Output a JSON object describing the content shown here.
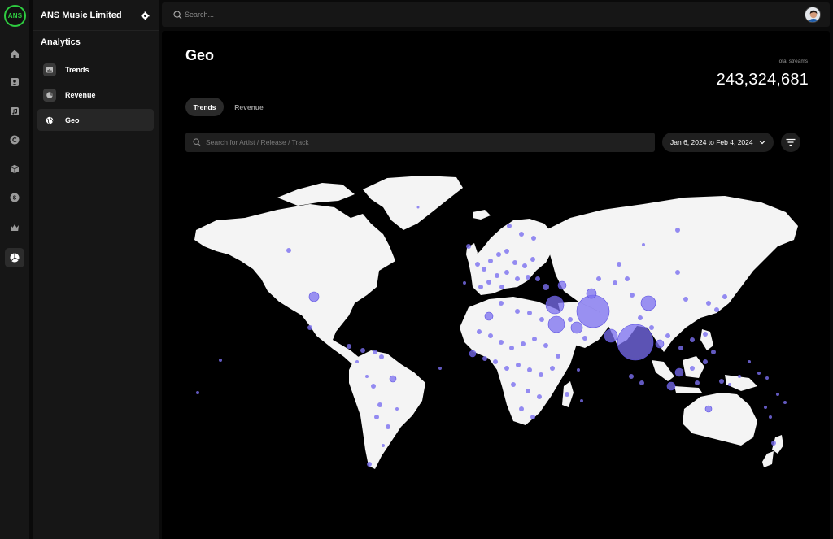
{
  "rail": {
    "logo": "ANS",
    "items": [
      {
        "icon": "home-icon"
      },
      {
        "icon": "artist-icon"
      },
      {
        "icon": "music-file-icon"
      },
      {
        "icon": "copyright-icon"
      },
      {
        "icon": "box-icon"
      },
      {
        "icon": "dollar-icon"
      },
      {
        "icon": "crown-icon"
      },
      {
        "icon": "analytics-icon",
        "active": true
      }
    ]
  },
  "sidebar": {
    "org_name": "ANS Music Limited",
    "section_title": "Analytics",
    "items": [
      {
        "label": "Trends",
        "icon": "trends-icon",
        "active": false
      },
      {
        "label": "Revenue",
        "icon": "revenue-icon",
        "active": false
      },
      {
        "label": "Geo",
        "icon": "globe-icon",
        "active": true
      }
    ]
  },
  "topbar": {
    "search_placeholder": "Search..."
  },
  "main": {
    "title": "Geo",
    "total_label": "Total streams",
    "total_value": "243,324,681",
    "tabs": [
      {
        "label": "Trends",
        "active": true
      },
      {
        "label": "Revenue",
        "active": false
      }
    ],
    "search_placeholder": "Search for Artist / Release / Track",
    "date_range": "Jan 6, 2024 to Feb 4, 2024"
  },
  "colors": {
    "bubble": "#7b6ff0",
    "land": "#f4f4f4",
    "accent_logo": "#2ecc40"
  }
}
